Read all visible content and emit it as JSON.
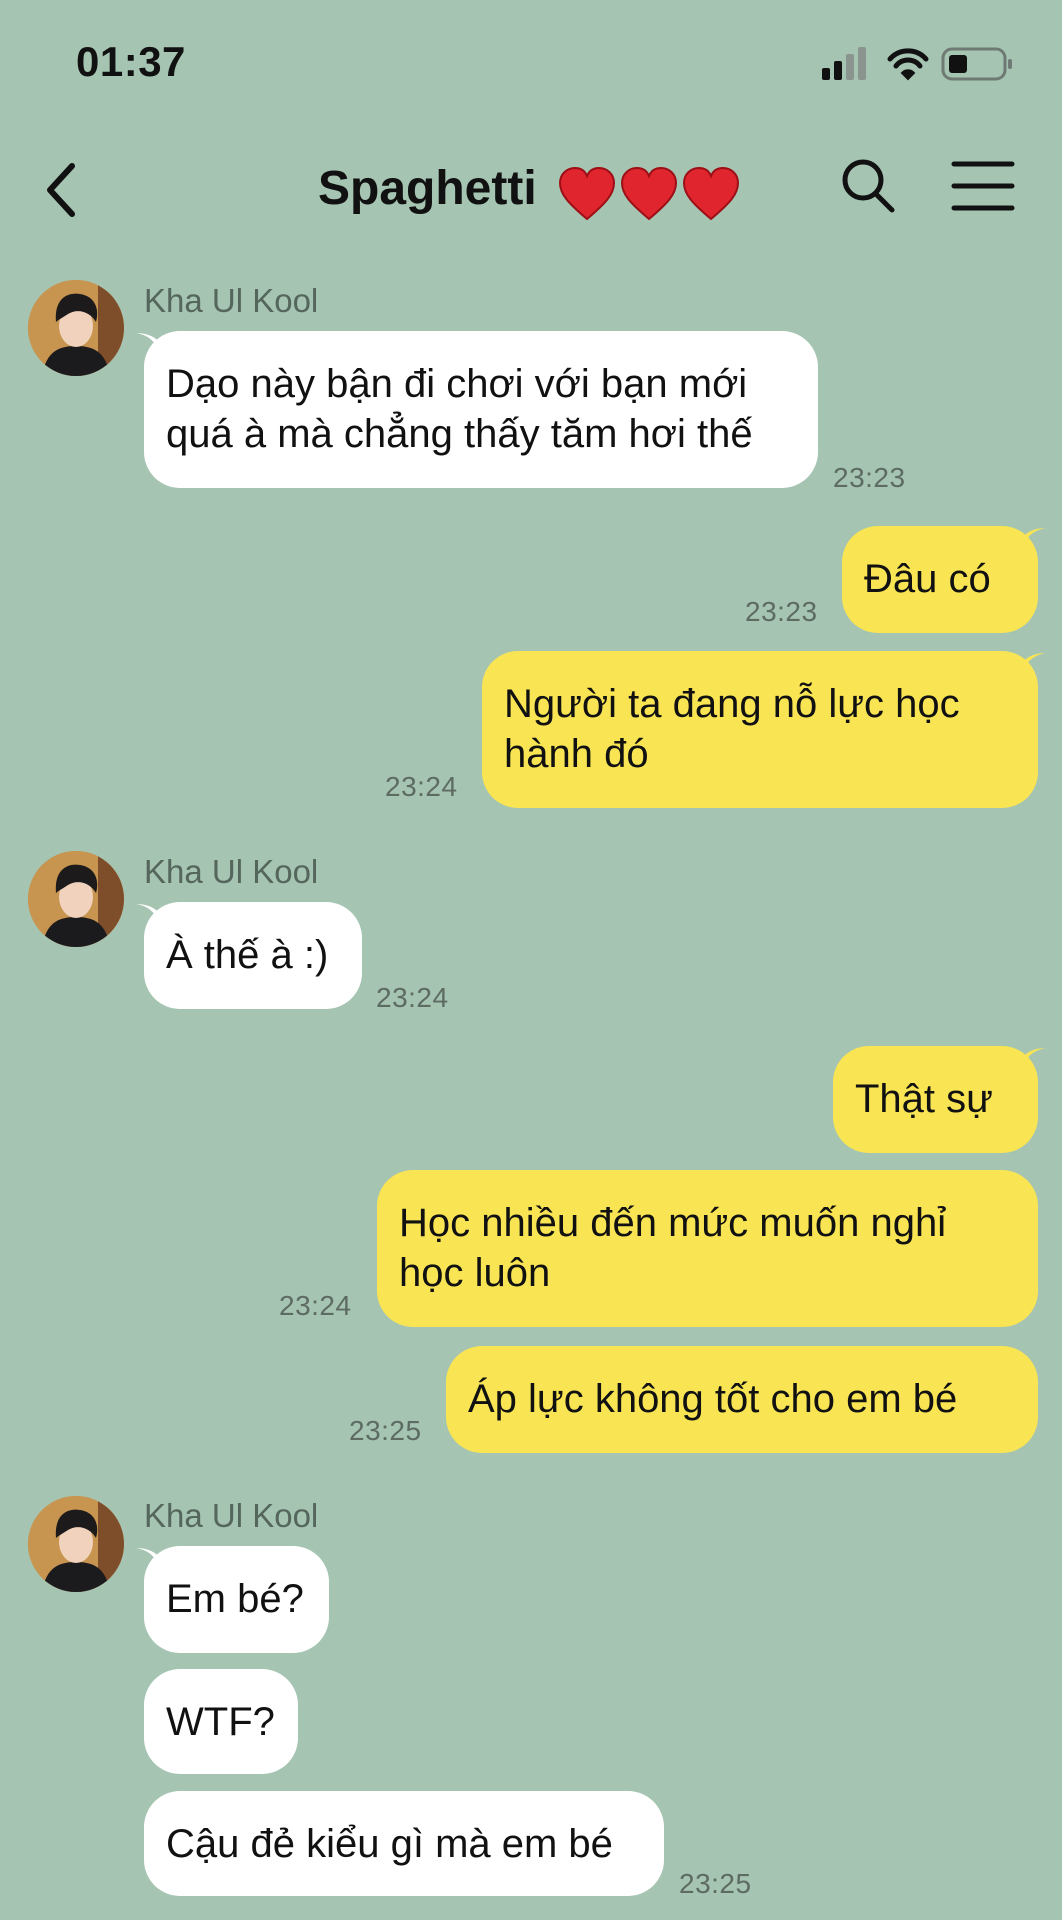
{
  "status_bar": {
    "time": "01:37",
    "icons": [
      "signal-icon",
      "wifi-icon",
      "battery-icon"
    ]
  },
  "header": {
    "title": "Spaghetti",
    "title_emoji": "❤️❤️❤️",
    "back_icon": "chevron-left-icon",
    "search_icon": "search-icon",
    "menu_icon": "hamburger-menu-icon"
  },
  "colors": {
    "background": "#a5c4b2",
    "incoming_bubble": "#ffffff",
    "outgoing_bubble": "#f9e553"
  },
  "messages": [
    {
      "direction": "in",
      "sender": "Kha Ul Kool",
      "lines": [
        "Dạo này bận đi chơi với bạn mới",
        "quá à mà chẳng thấy tăm hơi thế"
      ],
      "time": "23:23"
    },
    {
      "direction": "out",
      "lines": [
        "Đâu có"
      ],
      "time": "23:23"
    },
    {
      "direction": "out",
      "lines": [
        "Người ta đang nỗ lực học",
        "hành đó"
      ],
      "time": "23:24"
    },
    {
      "direction": "in",
      "sender": "Kha Ul Kool",
      "lines": [
        "À thế à :)"
      ],
      "time": "23:24"
    },
    {
      "direction": "out",
      "lines": [
        "Thật sự"
      ],
      "time": ""
    },
    {
      "direction": "out",
      "lines": [
        "Học nhiều đến mức muốn nghỉ",
        "học luôn"
      ],
      "time": "23:24"
    },
    {
      "direction": "out",
      "lines": [
        "Áp lực không tốt cho em bé"
      ],
      "time": "23:25"
    },
    {
      "direction": "in",
      "sender": "Kha Ul Kool",
      "lines": [
        "Em bé?"
      ],
      "time": ""
    },
    {
      "direction": "in",
      "lines": [
        "WTF?"
      ],
      "time": ""
    },
    {
      "direction": "in",
      "lines": [
        "Cậu đẻ kiểu gì mà em bé"
      ],
      "time": "23:25"
    }
  ]
}
